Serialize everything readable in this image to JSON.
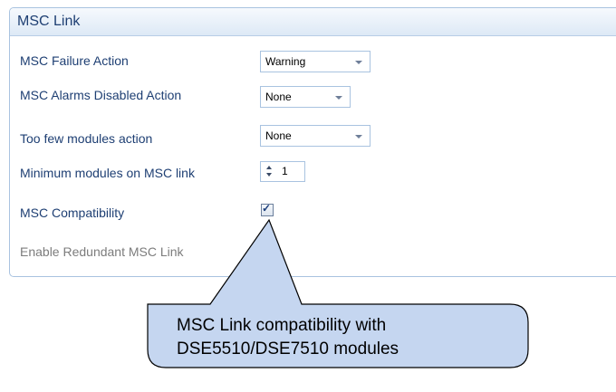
{
  "panel": {
    "title": "MSC Link"
  },
  "settings": {
    "failure_action": {
      "label": "MSC Failure Action",
      "value": "Warning"
    },
    "alarms_disabled_action": {
      "label": "MSC Alarms Disabled Action",
      "value": "None"
    },
    "too_few_modules_action": {
      "label": "Too few modules action",
      "value": "None"
    },
    "minimum_modules": {
      "label": "Minimum modules on MSC link",
      "value": "1"
    },
    "compatibility": {
      "label": "MSC Compatibility",
      "checked": true,
      "mark": "✓"
    },
    "redundant_link": {
      "label": "Enable Redundant MSC Link"
    }
  },
  "callout": {
    "line1": "MSC Link compatibility with",
    "line2": "DSE5510/DSE7510 modules",
    "fill": "#c5d6f0"
  }
}
